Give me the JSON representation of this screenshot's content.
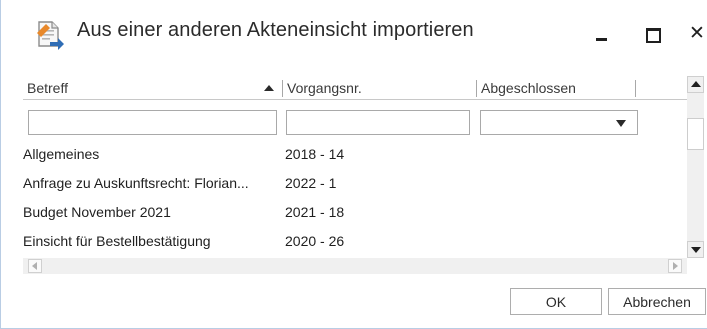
{
  "window": {
    "title": "Aus einer anderen Akteneinsicht importieren",
    "icon": "document-import-icon",
    "close_glyph": "✕"
  },
  "grid": {
    "columns": [
      {
        "label": "Betreff",
        "sorted": "ascending"
      },
      {
        "label": "Vorgangsnr."
      },
      {
        "label": "Abgeschlossen"
      }
    ],
    "filters": {
      "betreff": "",
      "vorgangsnr": "",
      "abgeschlossen": ""
    },
    "rows": [
      {
        "betreff": "Allgemeines",
        "vorgangsnr": "2018 - 14"
      },
      {
        "betreff": "Anfrage zu Auskunftsrecht: Florian...",
        "vorgangsnr": "2022 - 1"
      },
      {
        "betreff": "Budget November 2021",
        "vorgangsnr": "2021 - 18"
      },
      {
        "betreff": "Einsicht für Bestellbestätigung",
        "vorgangsnr": "2020 - 26"
      }
    ]
  },
  "buttons": {
    "ok": "OK",
    "cancel": "Abbrechen"
  },
  "colors": {
    "border_accent": "#b9cde4",
    "icon_orange": "#e8882a",
    "icon_blue": "#2f6db5"
  }
}
